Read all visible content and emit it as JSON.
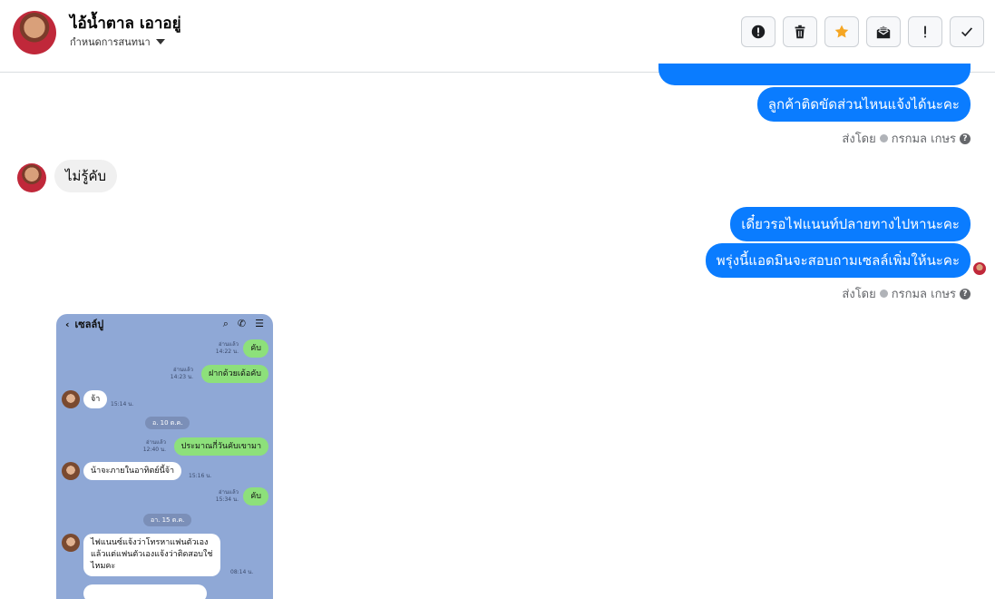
{
  "header": {
    "name": "ไอ้น้ำตาล เอาอยู่",
    "subtitle": "กำหนดการสนทนา",
    "tools": [
      "alert-circle-icon",
      "trash-icon",
      "star-icon",
      "mark-unread-icon",
      "exclamation-icon",
      "check-icon"
    ],
    "star_color": "#f5a623"
  },
  "messages": {
    "out1": "ลูกค้าติดขัดส่วนไหนแจ้งได้นะคะ",
    "sent_by_1": "ส่งโดย",
    "sender_1": "กรกมล เกษร",
    "in1": "ไม่รู้คับ",
    "out2": "เดี๋ยวรอไฟแนนท์ปลายทางไปหานะคะ",
    "out3": "พรุ่งนี้แอดมินจะสอบถามเซลล์เพิ่มให้นะคะ",
    "sent_by_2": "ส่งโดย",
    "sender_2": "กรกมล เกษร",
    "bubble_color": "#0a7cff"
  },
  "screenshot": {
    "title": "เซลล์ปู",
    "read_label": "อ่านแล้ว",
    "m1": "คับ",
    "t1": "14:22 น.",
    "m2": "ฝากด้วยเด้อคับ",
    "t2": "14:23 น.",
    "m3": "จ้า",
    "t3": "15:14 น.",
    "date1": "อ. 10 ต.ค.",
    "m4": "ประมาณกี่วันคับเขามา",
    "t4": "12:40 น.",
    "m5": "น้าจะภายในอาทิตย์นี้จ้า",
    "t5": "15:16 น.",
    "m6": "คับ",
    "t6": "15:34 น.",
    "date2": "อา. 15 ต.ค.",
    "m7a": "ไฟแนนซ์แจ้งว่าโทรหาแฟนตัวเอง",
    "m7b": "แล้วแต่แฟนตัวเองแจ้งว่าติดสอบใช่",
    "m7c": "ไหมคะ",
    "t7": "08:14 น."
  }
}
